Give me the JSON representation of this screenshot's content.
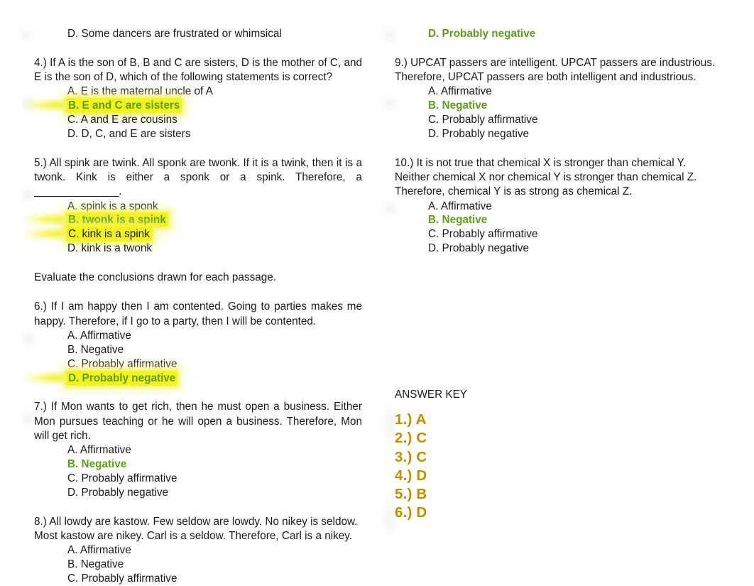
{
  "document": {
    "title": "Logical Reasoning Practice Items",
    "background_color": "#ffffff",
    "text_color": "#1a1a1a",
    "correct_answer_color": "#5f9c21",
    "highlight_color": "#f2f21e",
    "answer_key_color": "#bf8f00"
  },
  "left_column": {
    "orphan_option": {
      "letter": "D.",
      "text": "D. Some dancers are frustrated or whimsical",
      "correct": false,
      "highlighted": false
    },
    "questions": [
      {
        "number": "4.)",
        "stem": "4.) If A is the son of B, B and C are sisters, D is the mother of C, and E is the son of D, which of the following statements is correct?",
        "options": [
          {
            "text": "A. E is the maternal uncle of A",
            "correct": false,
            "highlighted": false
          },
          {
            "text": "B. E and C are sisters",
            "correct": true,
            "highlighted": true
          },
          {
            "text": "C. A and E are cousins",
            "correct": false,
            "highlighted": false
          },
          {
            "text": "D. D, C, and E are sisters",
            "correct": false,
            "highlighted": false
          }
        ]
      },
      {
        "number": "5.)",
        "stem": "5.) All spink are twink. All sponk are twonk. If it is a twink, then it is a twonk. Kink is either a sponk or a spink. Therefore, a ______________.",
        "options": [
          {
            "text": "A. spink is a sponk",
            "correct": false,
            "highlighted": false
          },
          {
            "text": "B. twonk is a spink",
            "correct": true,
            "highlighted": true
          },
          {
            "text": "C. kink is a spink",
            "correct": false,
            "highlighted": true
          },
          {
            "text": "D. kink is a twonk",
            "correct": false,
            "highlighted": false
          }
        ]
      }
    ],
    "instruction": "Evaluate the conclusions drawn for each passage.",
    "questions_after_instruction": [
      {
        "number": "6.)",
        "stem": "6.) If I am happy then I am contented. Going to parties makes me happy. Therefore, if I go to a party, then I will be contented.",
        "options": [
          {
            "text": "A. Affirmative",
            "correct": false,
            "highlighted": false
          },
          {
            "text": "B. Negative",
            "correct": false,
            "highlighted": false
          },
          {
            "text": "C. Probably affirmative",
            "correct": false,
            "highlighted": false
          },
          {
            "text": "D. Probably negative",
            "correct": true,
            "highlighted": true
          }
        ]
      },
      {
        "number": "7.)",
        "stem": "7.) If Mon wants to get rich, then he must open a business. Either Mon pursues teaching or he will open a business. Therefore, Mon will get rich.",
        "options": [
          {
            "text": "A. Affirmative",
            "correct": false,
            "highlighted": false
          },
          {
            "text": "B. Negative",
            "correct": true,
            "highlighted": false
          },
          {
            "text": "C. Probably affirmative",
            "correct": false,
            "highlighted": false
          },
          {
            "text": "D. Probably negative",
            "correct": false,
            "highlighted": false
          }
        ]
      },
      {
        "number": "8.)",
        "stem": "8.) All lowdy are kastow. Few seldow are lowdy. No nikey is seldow. Most kastow are nikey. Carl is a seldow. Therefore, Carl is a nikey.",
        "options": [
          {
            "text": "A. Affirmative",
            "correct": false,
            "highlighted": false
          },
          {
            "text": "B. Negative",
            "correct": false,
            "highlighted": false
          },
          {
            "text": "C. Probably affirmative",
            "correct": false,
            "highlighted": false
          }
        ]
      }
    ]
  },
  "right_column": {
    "continued_option": {
      "text": "D. Probably negative",
      "correct": true,
      "highlighted": false
    },
    "questions": [
      {
        "number": "9.)",
        "stem": "9.) UPCAT passers are intelligent. UPCAT passers are industrious. Therefore, UPCAT passers are both intelligent and industrious.",
        "options": [
          {
            "text": "A. Affirmative",
            "correct": false,
            "highlighted": false
          },
          {
            "text": "B. Negative",
            "correct": true,
            "highlighted": false
          },
          {
            "text": "C. Probably affirmative",
            "correct": false,
            "highlighted": false
          },
          {
            "text": "D. Probably negative",
            "correct": false,
            "highlighted": false
          }
        ]
      },
      {
        "number": "10.)",
        "stem": "10.) It is not true that chemical X is stronger than chemical Y. Neither chemical X nor chemical Y is stronger than chemical Z. Therefore, chemical Y is as strong as chemical Z.",
        "options": [
          {
            "text": "A. Affirmative",
            "correct": false,
            "highlighted": false
          },
          {
            "text": "B. Negative",
            "correct": true,
            "highlighted": false
          },
          {
            "text": "C. Probably affirmative",
            "correct": false,
            "highlighted": false
          },
          {
            "text": "D. Probably negative",
            "correct": false,
            "highlighted": false
          }
        ]
      }
    ],
    "answer_key": {
      "heading": "ANSWER KEY",
      "entries": [
        "1.) A",
        "2.) C",
        "3.) C",
        "4.) D",
        "5.) B",
        "6.) D"
      ]
    }
  }
}
